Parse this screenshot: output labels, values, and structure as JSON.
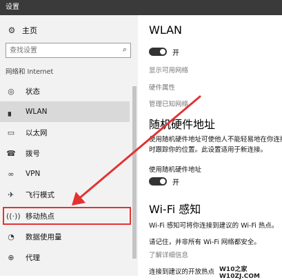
{
  "window": {
    "title": "设置"
  },
  "sidebar": {
    "home_label": "主页",
    "search_placeholder": "查找设置",
    "section_title": "网络和 Internet",
    "items": [
      {
        "label": "状态",
        "icon": "status-icon"
      },
      {
        "label": "WLAN",
        "icon": "wifi-signal-icon",
        "active": true
      },
      {
        "label": "以太网",
        "icon": "ethernet-icon"
      },
      {
        "label": "拨号",
        "icon": "dialup-icon"
      },
      {
        "label": "VPN",
        "icon": "vpn-icon"
      },
      {
        "label": "飞行模式",
        "icon": "airplane-icon"
      },
      {
        "label": "移动热点",
        "icon": "hotspot-icon",
        "highlighted": true
      },
      {
        "label": "数据使用量",
        "icon": "data-usage-icon"
      },
      {
        "label": "代理",
        "icon": "proxy-icon"
      }
    ]
  },
  "main": {
    "wlan": {
      "title": "WLAN",
      "toggle_state": "开",
      "links": [
        "显示可用网络",
        "硬件属性",
        "管理已知网络"
      ]
    },
    "random_hw": {
      "title": "随机硬件地址",
      "description_line1": "使用随机硬件地址可使他人不能轻易地在你连接",
      "description_line2": "时跟踪你的位置。此设置适用于新连接。",
      "setting_label": "使用随机硬件地址",
      "toggle_state": "开"
    },
    "wifi_sense": {
      "title": "Wi-Fi 感知",
      "line1": "Wi-Fi 感知可将你连接到建议的 Wi-Fi 热点。",
      "line2": "请记住，并非所有 Wi-Fi 网络都安全。",
      "learn_more": "了解详细信息",
      "connect_label": "连接到建议的开放热点"
    }
  },
  "watermark": "W10之家 W10ZJ.COM",
  "colors": {
    "annotation_red": "#e23232",
    "sidebar_bg": "#f2f2f2",
    "titlebar_bg": "#3a3a3a"
  }
}
